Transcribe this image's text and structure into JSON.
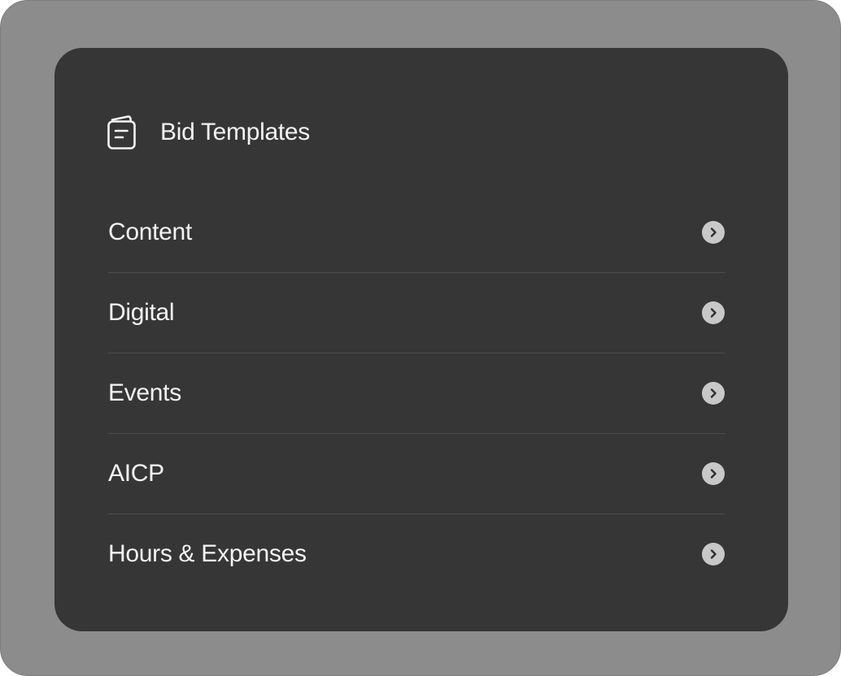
{
  "panel": {
    "title": "Bid Templates",
    "title_icon": "document-icon"
  },
  "menu": {
    "items": [
      {
        "label": "Content",
        "icon": "chevron-right-icon"
      },
      {
        "label": "Digital",
        "icon": "chevron-right-icon"
      },
      {
        "label": "Events",
        "icon": "chevron-right-icon"
      },
      {
        "label": "AICP",
        "icon": "chevron-right-icon"
      },
      {
        "label": "Hours & Expenses",
        "icon": "chevron-right-icon"
      }
    ]
  },
  "colors": {
    "outer_background": "#8c8c8c",
    "panel_background": "#363636",
    "text": "#f4f4f4",
    "divider": "#4c4c4c",
    "chevron_badge": "#c8c8c8"
  }
}
